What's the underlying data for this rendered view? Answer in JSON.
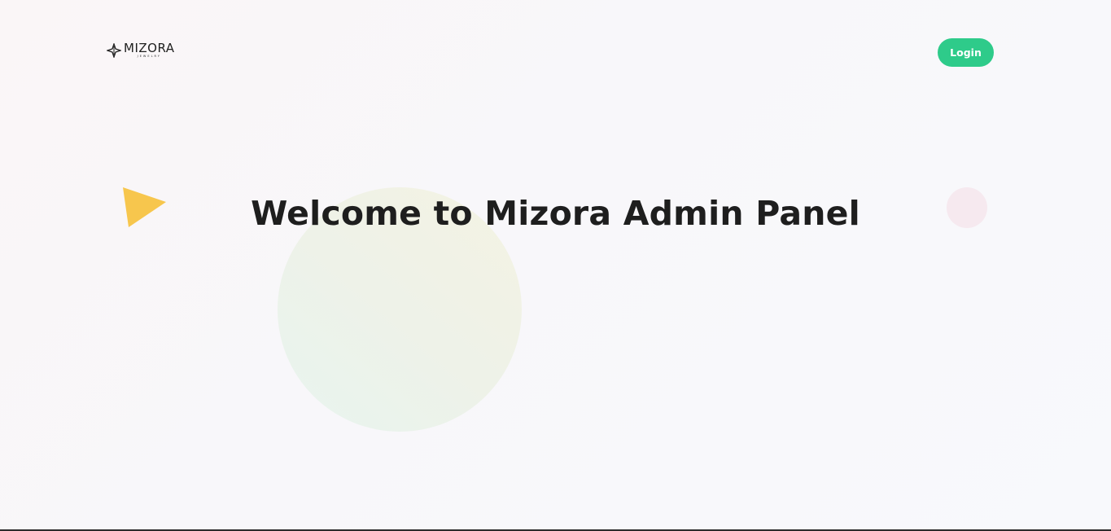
{
  "brand": {
    "name": "MIZORA",
    "tagline": "JEWELRY"
  },
  "header": {
    "login_label": "Login"
  },
  "hero": {
    "title": "Welcome to Mizora Admin Panel"
  },
  "colors": {
    "accent": "#2ecb8a",
    "triangle": "#f7c64d",
    "pink_dot": "#f6e9ef",
    "text": "#1e1e1e"
  }
}
